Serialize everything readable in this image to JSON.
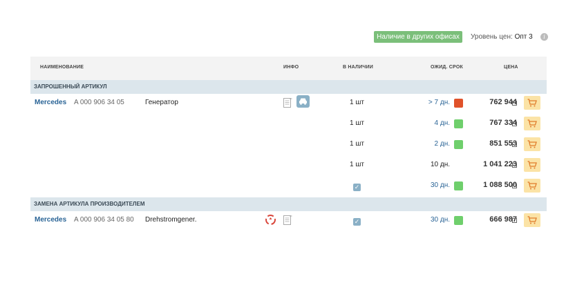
{
  "top": {
    "availability_button": "Наличие в других офисах",
    "price_level_label": "Уровень цен:",
    "price_level_value": "Опт 3",
    "info_glyph": "i"
  },
  "table": {
    "headers": {
      "name": "НАИМЕНОВАНИЕ",
      "info": "ИНФО",
      "stock": "В НАЛИЧИИ",
      "term": "ОЖИД. СРОК",
      "price": "ЦЕНА"
    },
    "section1": {
      "title": "ЗАПРОШЕННЫЙ АРТИКУЛ",
      "rows": [
        {
          "brand": "Mercedes",
          "article": "A 000 906 34 05",
          "name": "Генератор",
          "qty": "1 шт",
          "term": "> 7 дн.",
          "price": "762 944"
        },
        {
          "qty": "1 шт",
          "term": "4 дн.",
          "price": "767 334"
        },
        {
          "qty": "1 шт",
          "term": "2 дн.",
          "price": "851 553"
        },
        {
          "qty": "1 шт",
          "term": "10 дн.",
          "price": "1 041 223"
        },
        {
          "check": "✓",
          "term": "30 дн.",
          "price": "1 088 500"
        }
      ]
    },
    "section2": {
      "title": "ЗАМЕНА АРТИКУЛА ПРОИЗВОДИТЕЛЕМ",
      "rows": [
        {
          "brand": "Mercedes",
          "article": "A 000 906 34 05 80",
          "name": "Drehstromgener.",
          "check": "✓",
          "term": "30 дн.",
          "price": "666 987"
        }
      ]
    }
  },
  "colors": {
    "status_red": "#e0522a",
    "status_green": "#6fcf6c",
    "link": "#2a6496",
    "cart_bg": "#fbe3a6",
    "section_bg": "#dce6ec"
  },
  "icons": {
    "doc": "document-icon",
    "car": "car-icon",
    "recycle": "recycle-icon",
    "cart": "cart-icon"
  }
}
